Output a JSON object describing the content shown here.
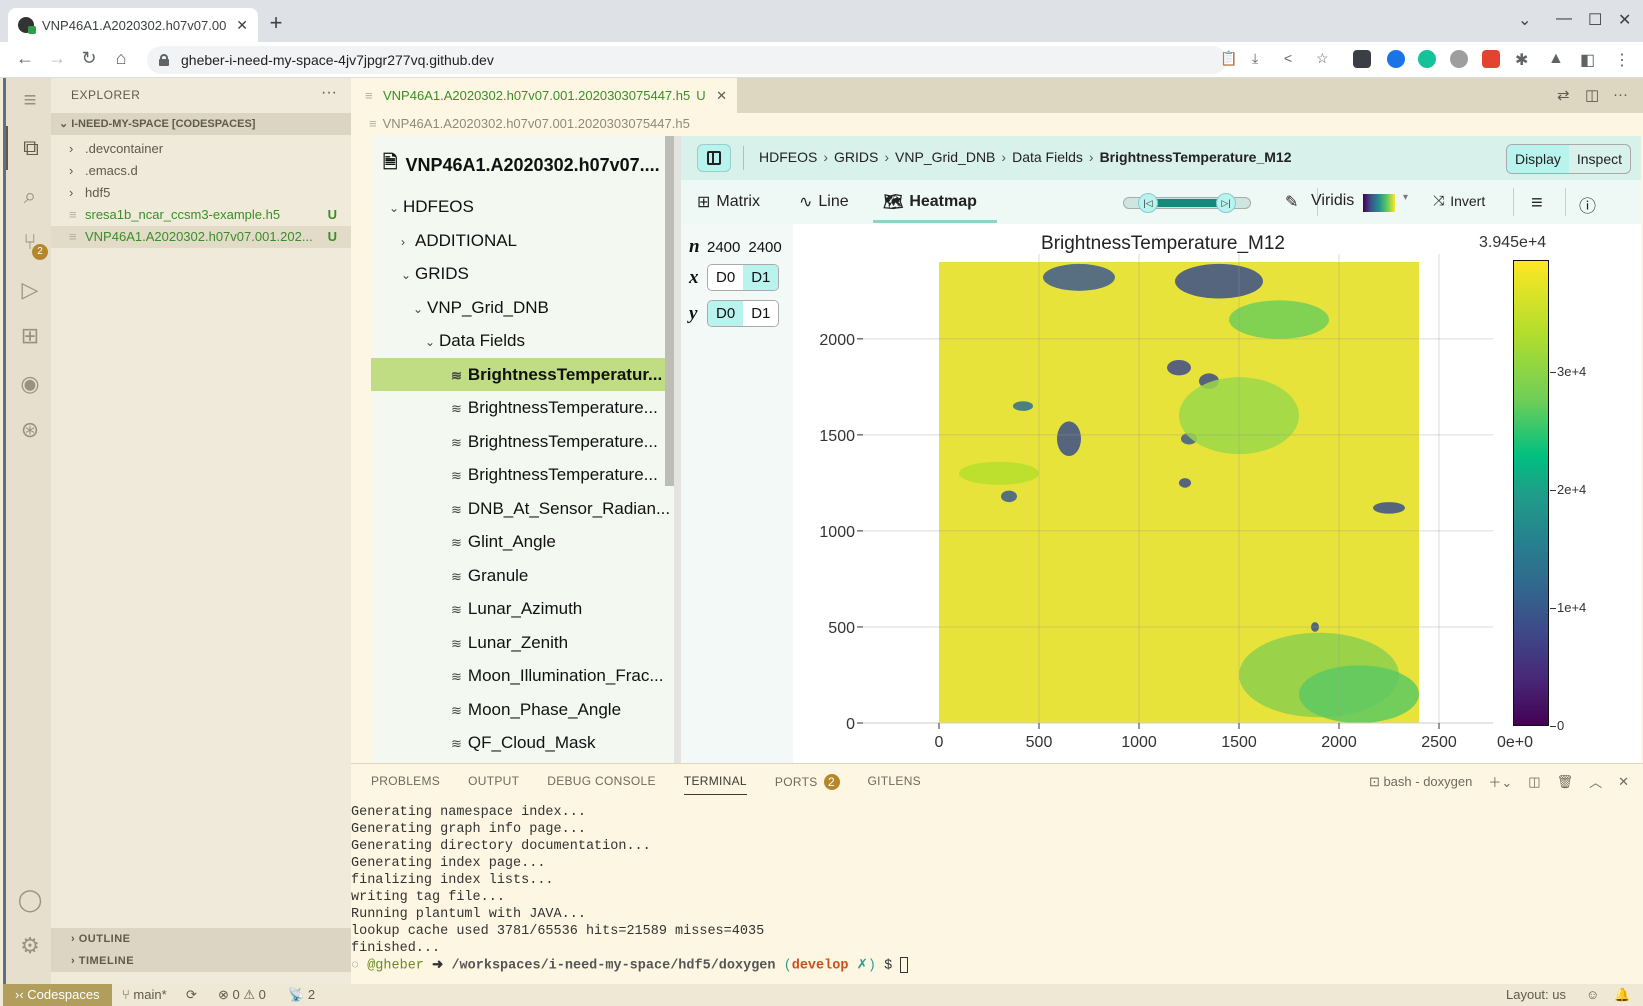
{
  "browser": {
    "tab_title": "VNP46A1.A2020302.h07v07.00",
    "url": "gheber-i-need-my-space-4jv7jpgr277vq.github.dev",
    "extensions": [
      {
        "name": "password-manager-icon",
        "color": "#3a3f45"
      },
      {
        "name": "circle-c-icon",
        "color": "#1a73e8"
      },
      {
        "name": "grammarly-icon",
        "color": "#15c39a"
      },
      {
        "name": "power-icon",
        "color": "#9e9e9e"
      },
      {
        "name": "todoist-icon",
        "color": "#e44332"
      }
    ]
  },
  "sidebar": {
    "header": "EXPLORER",
    "workspace": "I-NEED-MY-SPACE [CODESPACES]",
    "items": [
      {
        "label": ".devcontainer",
        "type": "folder"
      },
      {
        "label": ".emacs.d",
        "type": "folder"
      },
      {
        "label": "hdf5",
        "type": "folder"
      },
      {
        "label": "sresa1b_ncar_ccsm3-example.h5",
        "type": "file",
        "status": "U"
      },
      {
        "label": "VNP46A1.A2020302.h07v07.001.202...",
        "type": "file",
        "status": "U"
      }
    ],
    "outline": "OUTLINE",
    "timeline": "TIMELINE",
    "scm_badge": "2"
  },
  "editor": {
    "tab_label": "VNP46A1.A2020302.h07v07.001.2020303075447.h5",
    "tab_status": "U",
    "breadcrumb": "VNP46A1.A2020302.h07v07.001.2020303075447.h5"
  },
  "h5web": {
    "file_title": "VNP46A1.A2020302.h07v07....",
    "tree": [
      {
        "label": "HDFEOS",
        "level": 0,
        "chev": "⌄"
      },
      {
        "label": "ADDITIONAL",
        "level": 1,
        "chev": "›"
      },
      {
        "label": "GRIDS",
        "level": 1,
        "chev": "⌄"
      },
      {
        "label": "VNP_Grid_DNB",
        "level": 2,
        "chev": "⌄"
      },
      {
        "label": "Data Fields",
        "level": 3,
        "chev": "⌄"
      },
      {
        "label": "BrightnessTemperatur...",
        "level": 4,
        "dataset": true,
        "selected": true
      },
      {
        "label": "BrightnessTemperature...",
        "level": 4,
        "dataset": true
      },
      {
        "label": "BrightnessTemperature...",
        "level": 4,
        "dataset": true
      },
      {
        "label": "BrightnessTemperature...",
        "level": 4,
        "dataset": true
      },
      {
        "label": "DNB_At_Sensor_Radian...",
        "level": 4,
        "dataset": true
      },
      {
        "label": "Glint_Angle",
        "level": 4,
        "dataset": true
      },
      {
        "label": "Granule",
        "level": 4,
        "dataset": true
      },
      {
        "label": "Lunar_Azimuth",
        "level": 4,
        "dataset": true
      },
      {
        "label": "Lunar_Zenith",
        "level": 4,
        "dataset": true
      },
      {
        "label": "Moon_Illumination_Frac...",
        "level": 4,
        "dataset": true
      },
      {
        "label": "Moon_Phase_Angle",
        "level": 4,
        "dataset": true
      },
      {
        "label": "QF_Cloud_Mask",
        "level": 4,
        "dataset": true
      }
    ],
    "path": [
      "HDFEOS",
      "GRIDS",
      "VNP_Grid_DNB",
      "Data Fields"
    ],
    "path_current": "BrightnessTemperature_M12",
    "mode_display": "Display",
    "mode_inspect": "Inspect",
    "vis_tabs": [
      "Matrix",
      "Line",
      "Heatmap"
    ],
    "active_vis": "Heatmap",
    "colormap": "Viridis",
    "invert_label": "Invert",
    "dims": {
      "n_label": "n",
      "n_values": [
        "2400",
        "2400"
      ],
      "x_label": "x",
      "y_label": "y",
      "x_options": [
        "D0",
        "D1"
      ],
      "x_selected": "D1",
      "y_options": [
        "D0",
        "D1"
      ],
      "y_selected": "D0"
    }
  },
  "chart_data": {
    "type": "heatmap",
    "title": "BrightnessTemperature_M12",
    "xlim": [
      0,
      2400
    ],
    "ylim": [
      0,
      2400
    ],
    "xticks": [
      "0",
      "500",
      "1000",
      "1500",
      "2000",
      "2500"
    ],
    "yticks": [
      "0",
      "500",
      "1000",
      "1500",
      "2000"
    ],
    "colormap": "viridis",
    "color_range": [
      0,
      39450
    ],
    "colorbar_max_label": "3.945e+4",
    "colorbar_min_label": "0e+0",
    "colorbar_ticks": [
      "3e+4",
      "2e+4",
      "1e+4",
      "0"
    ],
    "grid": true
  },
  "panel": {
    "tabs": [
      "PROBLEMS",
      "OUTPUT",
      "DEBUG CONSOLE",
      "TERMINAL",
      "PORTS",
      "GITLENS"
    ],
    "active": "TERMINAL",
    "ports_badge": "2",
    "terminal_name": "bash - doxygen",
    "lines": [
      "Generating namespace index...",
      "Generating graph info page...",
      "Generating directory documentation...",
      "Generating index page...",
      "finalizing index lists...",
      "writing tag file...",
      "Running plantuml with JAVA...",
      "lookup cache used 3781/65536 hits=21589 misses=4035",
      "finished..."
    ],
    "prompt_user": "@gheber",
    "prompt_path": "/workspaces/i-need-my-space/hdf5/doxygen",
    "prompt_branch": "develop",
    "prompt_dirty": "✗"
  },
  "status": {
    "remote": "Codespaces",
    "branch": "main*",
    "errors": "0",
    "warnings": "0",
    "ports": "2",
    "layout": "Layout: us"
  }
}
